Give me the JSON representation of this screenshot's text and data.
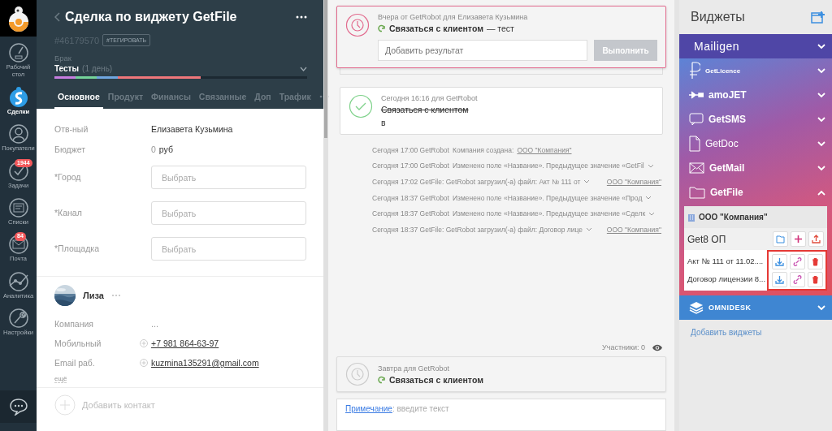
{
  "nav": {
    "items": [
      {
        "kind": "dashboard",
        "label": "Рабочий\nстол",
        "selected": false
      },
      {
        "kind": "deals",
        "label": "Сделки",
        "selected": true
      },
      {
        "kind": "customers",
        "label": "Покупатели",
        "selected": false
      },
      {
        "kind": "tasks",
        "label": "Задачи",
        "badge": "1944",
        "selected": false
      },
      {
        "kind": "lists",
        "label": "Списки",
        "selected": false
      },
      {
        "kind": "mail",
        "label": "Почта",
        "badge": "84",
        "selected": false
      },
      {
        "kind": "analytics",
        "label": "Аналитика",
        "selected": false
      },
      {
        "kind": "settings",
        "label": "Настройки",
        "selected": false
      }
    ]
  },
  "deal": {
    "title": "Сделка по виджету GetFile",
    "id": "#46179570",
    "tag": "#ТЕГИРОВАТЬ",
    "pipeline": "Брак",
    "stage": "Тесты",
    "stage_duration": "(1 день)",
    "progress": {
      "level": 0.58
    },
    "tabs": [
      {
        "label": "Основное",
        "selected": true
      },
      {
        "label": "Продукт",
        "selected": false
      },
      {
        "label": "Финансы",
        "selected": false
      },
      {
        "label": "Связанные",
        "selected": false
      },
      {
        "label": "Доп",
        "selected": false
      },
      {
        "label": "Трафик",
        "selected": false
      }
    ],
    "fields": [
      {
        "kind": "text",
        "label": "Отв-ный",
        "value": "Елизавета Кузьмина"
      },
      {
        "kind": "money",
        "label": "Бюджет",
        "amount": "0",
        "currency": "руб"
      },
      {
        "kind": "select",
        "label": "*Город",
        "placeholder": "Выбрать"
      },
      {
        "kind": "select",
        "label": "*Канал",
        "placeholder": "Выбрать"
      },
      {
        "kind": "select",
        "label": "*Площадка",
        "placeholder": "Выбрать"
      }
    ],
    "contact": {
      "name": "Лиза",
      "fields": [
        {
          "kind": "plain",
          "label": "Компания",
          "value": "..."
        },
        {
          "kind": "link",
          "label": "Мобильный",
          "value": "+7 981 864-63-97"
        },
        {
          "kind": "link",
          "label": "Email раб.",
          "value": "kuzmina135291@gmail.com"
        }
      ],
      "more": "ещё"
    },
    "add_contact": "Добавить контакт"
  },
  "feed": {
    "active_task": {
      "meta": "Вчера от GetRobot для Елизавета Кузьмина",
      "title": "Связаться с клиентом",
      "comment": "— тест",
      "placeholder": "Добавить результат",
      "button": "Выполнить"
    },
    "done_task": {
      "meta": "Сегодня 16:16  для GetRobot",
      "title": "Связаться с клиентом",
      "result": "в"
    },
    "events": [
      {
        "meta": "Сегодня 17:00 GetRobot",
        "text": "Компания создана:",
        "expandable": false,
        "link": "ООО \"Компания\""
      },
      {
        "meta": "Сегодня 17:00 GetRobot",
        "text": "Изменено поле «Название». Предыдущее значение «GetFil",
        "expandable": true
      },
      {
        "meta": "Сегодня 17:02 GetFile: GetRobot загрузил(-а) файл: Акт № 111 от",
        "expandable": true,
        "link": "ООО \"Компания\""
      },
      {
        "meta": "Сегодня 18:37 GetRobot",
        "text": "Изменено поле «Название». Предыдущее значение «Прод",
        "expandable": true
      },
      {
        "meta": "Сегодня 18:37 GetRobot",
        "text": "Изменено поле «Название». Предыдущее значение «Сделк",
        "expandable": true
      },
      {
        "meta": "Сегодня 18:37 GetFile: GetRobot загрузил(-а) файл: Договор лице",
        "expandable": true,
        "link": "ООО \"Компания\""
      }
    ],
    "participants": "Участники: 0",
    "next_task": {
      "meta": "Завтра для GetRobot",
      "title": "Связаться с клиентом"
    },
    "note": {
      "link": "Примечание",
      "placeholder": ": введите текст"
    }
  },
  "widgets": {
    "title": "Виджеты",
    "groups": [
      {
        "kind": "banner",
        "color": "#4f46a6",
        "items": [
          {
            "kind": "mailigen",
            "name": "Mailigen",
            "expanded": false
          }
        ]
      },
      {
        "kind": "gradient",
        "items": [
          {
            "kind": "licence",
            "name": "GetLicence",
            "expanded": false
          },
          {
            "kind": "amojet",
            "name": "amoJET",
            "expanded": false
          },
          {
            "kind": "sms",
            "name": "GetSMS",
            "expanded": false
          },
          {
            "kind": "doc",
            "name": "GetDoc",
            "expanded": false
          },
          {
            "kind": "mail",
            "name": "GetMail",
            "expanded": false
          },
          {
            "kind": "folder",
            "name": "GetFile",
            "expanded": true
          }
        ],
        "panel": {
          "company": "ООО \"Компания\"",
          "folder": "Get8 ОП",
          "highlighted": true,
          "files": [
            "Акт № 111 от 11.02....",
            "Договор лицензии 8..."
          ]
        }
      },
      {
        "kind": "banner",
        "color": "#3f86d2",
        "items": [
          {
            "kind": "omnidesk",
            "name": "OMNIDESK",
            "expanded": false
          }
        ]
      }
    ],
    "add_link": "Добавить виджеты"
  }
}
